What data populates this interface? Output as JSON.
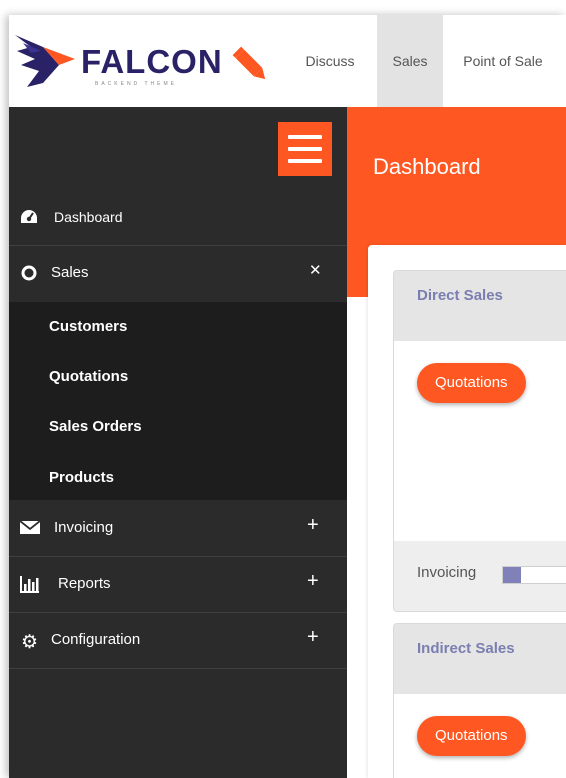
{
  "brand": {
    "name": "FALCON",
    "tagline": "BACKEND THEME",
    "icon": "pencil-icon"
  },
  "topnav": {
    "items": [
      {
        "label": "Discuss",
        "active": false
      },
      {
        "label": "Sales",
        "active": true
      },
      {
        "label": "Point of Sale",
        "active": false
      }
    ]
  },
  "sidebar": {
    "menu_icon": "hamburger-icon",
    "items": [
      {
        "label": "Dashboard",
        "icon": "dashboard-gauge-icon",
        "toggle": ""
      },
      {
        "label": "Sales",
        "icon": "circle-outline-icon",
        "toggle": "✕"
      },
      {
        "label": "Invoicing",
        "icon": "envelope-icon",
        "toggle": "+"
      },
      {
        "label": "Reports",
        "icon": "bar-chart-icon",
        "toggle": "+"
      },
      {
        "label": "Configuration",
        "icon": "gear-icon",
        "toggle": "+"
      }
    ],
    "sales_submenu": [
      "Customers",
      "Quotations",
      "Sales Orders",
      "Products"
    ]
  },
  "content": {
    "title": "Dashboard",
    "cards": [
      {
        "title": "Direct Sales",
        "button": "Quotations",
        "footer_label": "Invoicing",
        "progress": 0.28
      },
      {
        "title": "Indirect Sales",
        "button": "Quotations"
      }
    ]
  },
  "colors": {
    "accent": "#fe5722",
    "sidebar_bg": "#2b2b2b",
    "submenu_bg": "#1d1d1d",
    "card_title": "#7a7eb0",
    "progress_fill": "#8081b8",
    "logo_navy": "#2a2266"
  }
}
